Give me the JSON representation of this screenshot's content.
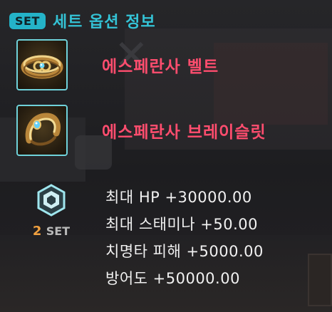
{
  "header": {
    "badge": "SET",
    "title": "세트 옵션 정보"
  },
  "items": [
    {
      "name": "에스페란사 벨트",
      "icon": "belt-icon"
    },
    {
      "name": "에스페란사 브레이슬릿",
      "icon": "bracelet-icon"
    }
  ],
  "set_bonus": {
    "count": "2",
    "count_suffix": "SET",
    "icon": "set-emblem-icon",
    "stats": [
      "최대 HP +30000.00",
      "최대 스태미나 +50.00",
      "치명타 피해 +5000.00",
      "방어도 +50000.00"
    ]
  },
  "colors": {
    "accent": "#24b3c8",
    "item_name": "#ff4d6e",
    "count": "#f0a040",
    "stat_text": "#f1f1f1"
  }
}
